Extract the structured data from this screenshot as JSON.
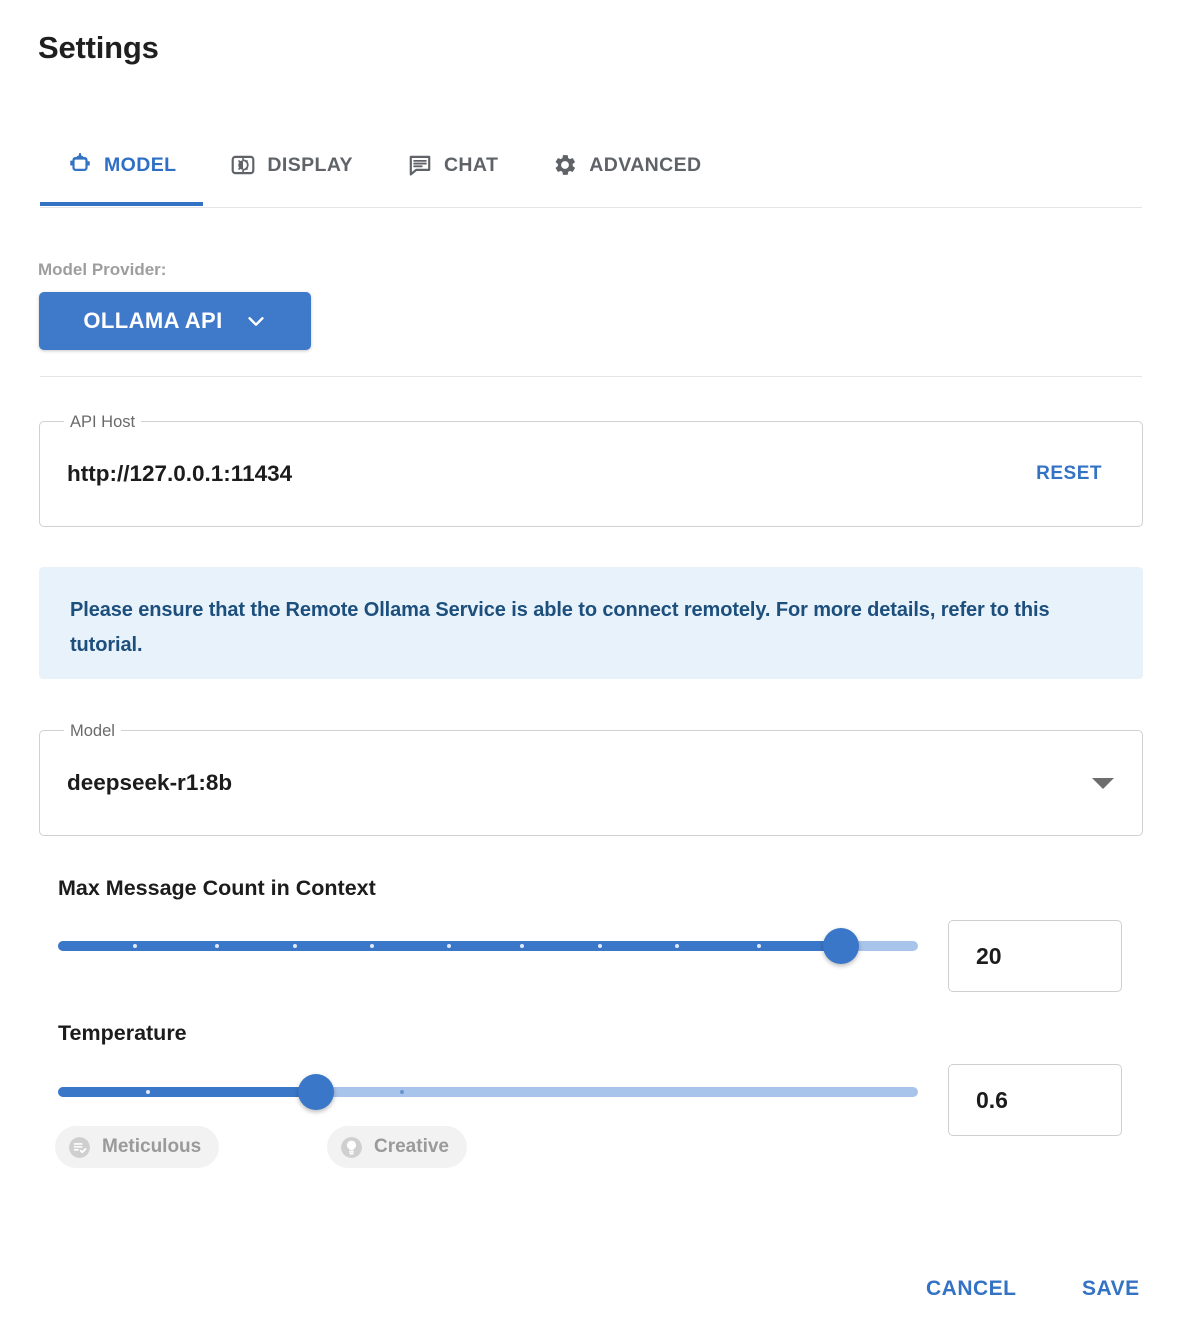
{
  "page": {
    "title": "Settings"
  },
  "tabs": [
    {
      "label": "MODEL",
      "icon": "robot-icon",
      "active": true
    },
    {
      "label": "DISPLAY",
      "icon": "brightness-icon",
      "active": false
    },
    {
      "label": "CHAT",
      "icon": "chat-bubble-icon",
      "active": false
    },
    {
      "label": "ADVANCED",
      "icon": "gear-icon",
      "active": false
    }
  ],
  "model_tab": {
    "provider": {
      "label": "Model Provider:",
      "selected": "OLLAMA API",
      "chevron": "chevron-down-icon"
    },
    "api_host": {
      "legend": "API Host",
      "value": "http://127.0.0.1:11434",
      "placeholder": "http://127.0.0.1:11434",
      "reset_label": "RESET"
    },
    "info_banner": {
      "text": "Please ensure that the Remote Ollama Service is able to connect remotely. For more details, refer to this tutorial."
    },
    "model_select": {
      "legend": "Model",
      "value": "deepseek-r1:8b"
    },
    "max_messages": {
      "title": "Max Message Count in Context",
      "value": "20",
      "fill_percent": 91,
      "tick_percent": [
        9,
        18.5,
        27.5,
        36.5,
        45.5,
        54,
        63,
        72,
        81.5
      ]
    },
    "temperature": {
      "title": "Temperature",
      "value": "0.6",
      "fill_percent": 30,
      "tick_percent": [
        10.5,
        40
      ],
      "chips": [
        {
          "label": "Meticulous",
          "icon": "rule-checklist-icon"
        },
        {
          "label": "Creative",
          "icon": "lightbulb-icon"
        }
      ]
    }
  },
  "footer": {
    "cancel_label": "CANCEL",
    "save_label": "SAVE"
  },
  "colors": {
    "accent": "#3472c4",
    "provider_button": "#3e79ca",
    "banner_bg": "#e8f2fb",
    "banner_text": "#1d4f7d",
    "track_active": "#3a77c9",
    "track_inactive": "#a9c4ea"
  }
}
